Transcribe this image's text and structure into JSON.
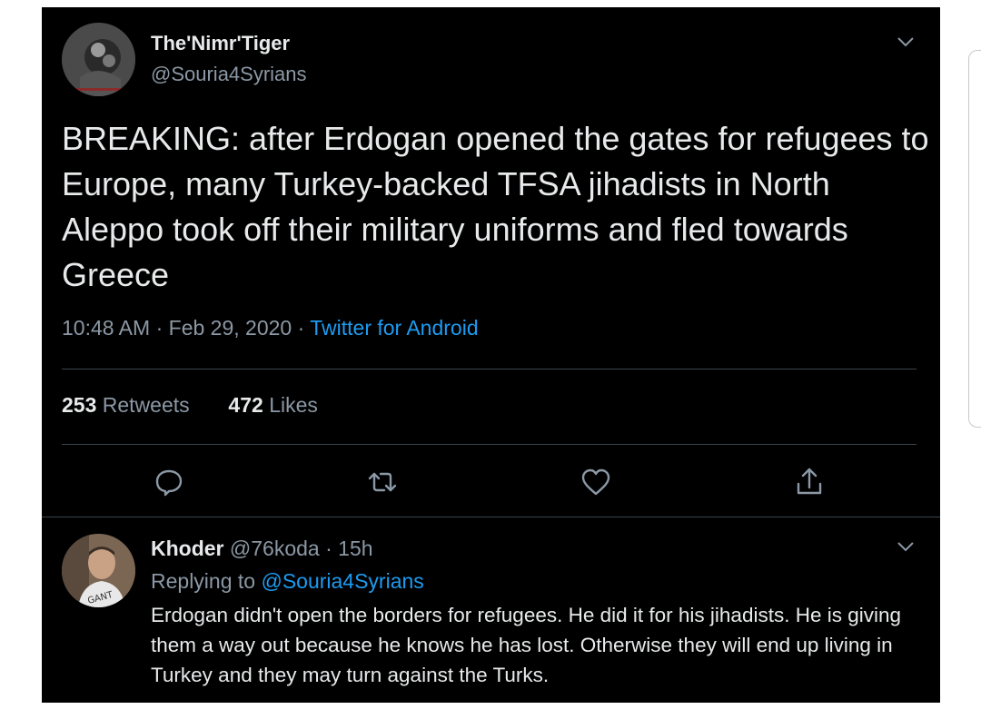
{
  "tweet": {
    "display_name": "The'Nimr'Tiger",
    "handle": "@Souria4Syrians",
    "text": "BREAKING: after Erdogan opened the gates for refugees to Europe, many Turkey-backed TFSA jihadists in North Aleppo took off their military uniforms and fled towards Greece",
    "time": "10:48 AM",
    "date": "Feb 29, 2020",
    "separator": "·",
    "source": "Twitter for Android",
    "retweets_count": "253",
    "retweets_label": "Retweets",
    "likes_count": "472",
    "likes_label": "Likes"
  },
  "actions": [
    {
      "icon": "reply-icon"
    },
    {
      "icon": "retweet-icon"
    },
    {
      "icon": "like-icon"
    },
    {
      "icon": "share-icon"
    }
  ],
  "reply": {
    "display_name": "Khoder",
    "handle": "@76koda",
    "separator": "·",
    "age": "15h",
    "replying_prefix": "Replying to",
    "replying_handle": "@Souria4Syrians",
    "text": "Erdogan didn't open the borders for refugees. He did it for his jihadists. He is giving them a way out because he knows he has lost. Otherwise they will end up living in Turkey and they may turn against the Turks."
  },
  "colors": {
    "background": "#000000",
    "text": "#e7e9ea",
    "secondary": "#8b98a5",
    "accent": "#1d9bf0",
    "divider": "#38444d"
  }
}
